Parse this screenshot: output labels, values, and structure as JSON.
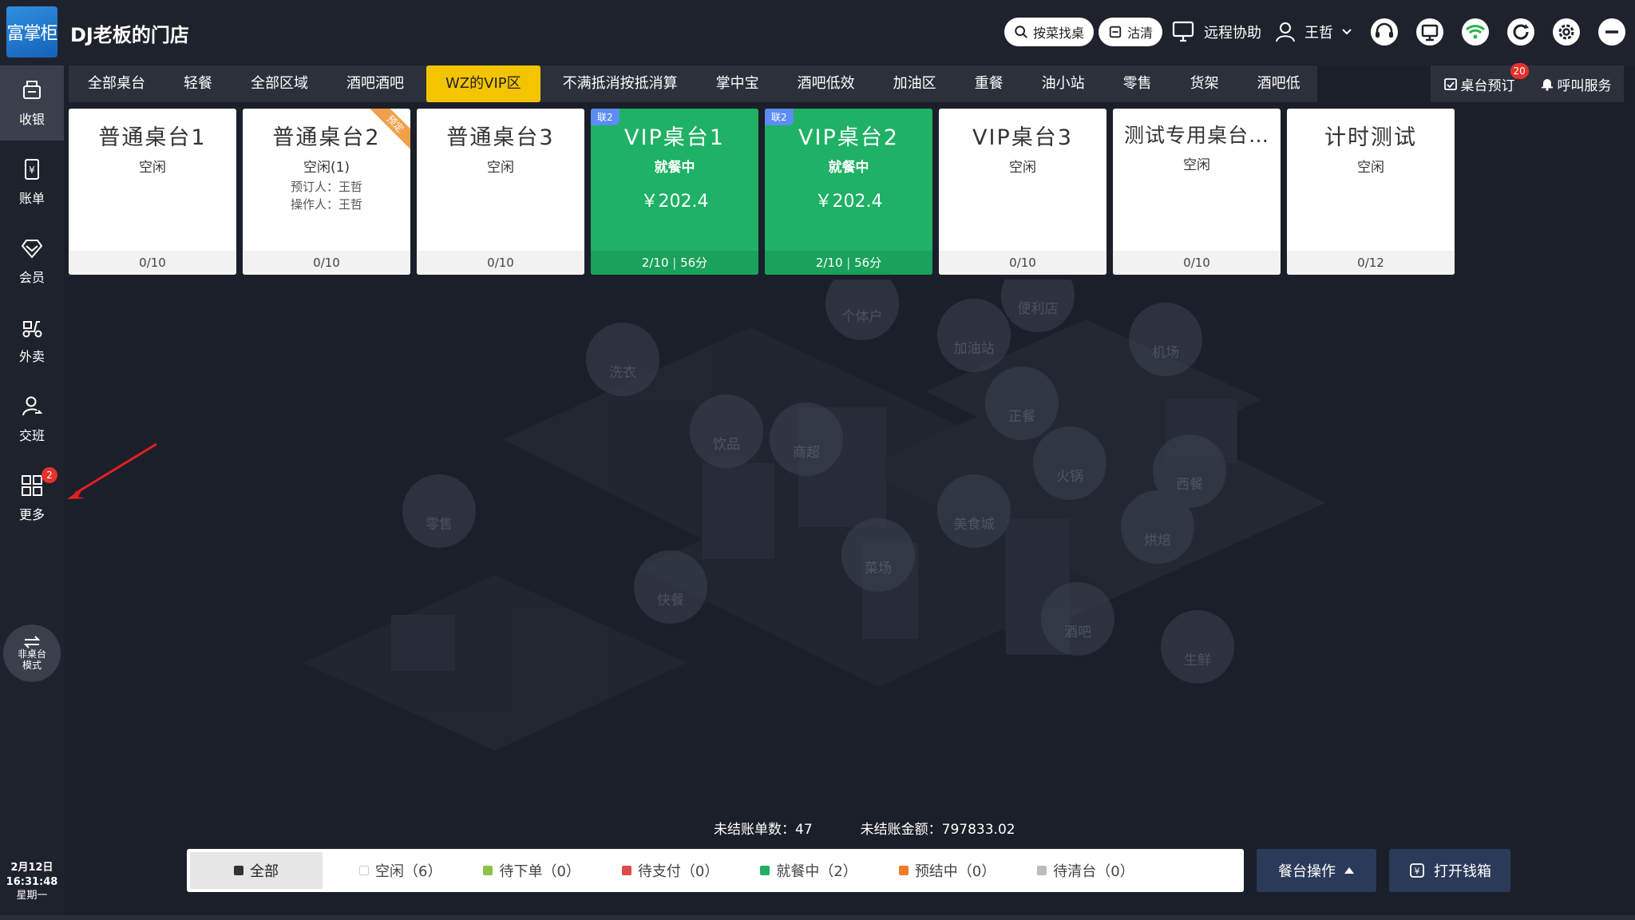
{
  "app": {
    "logo_text": "富掌柜",
    "store_name": "DJ老板的门店"
  },
  "header": {
    "search_table_label": "按菜找桌",
    "clean_label": "沽清",
    "remote_help_label": "远程协助",
    "user_name": "王哲"
  },
  "sidebar": {
    "items": [
      {
        "label": "收银"
      },
      {
        "label": "账单"
      },
      {
        "label": "会员"
      },
      {
        "label": "外卖"
      },
      {
        "label": "交班"
      },
      {
        "label": "更多",
        "badge": "2"
      }
    ],
    "mode_line1": "非桌台",
    "mode_line2": "模式",
    "date": "2月12日",
    "time": "16:31:48",
    "weekday": "星期一"
  },
  "tabs": {
    "items": [
      {
        "label": "全部桌台"
      },
      {
        "label": "轻餐"
      },
      {
        "label": "全部区域"
      },
      {
        "label": "酒吧酒吧"
      },
      {
        "label": "WZ的VIP区"
      },
      {
        "label": "不满抵消按抵消算"
      },
      {
        "label": "掌中宝"
      },
      {
        "label": "酒吧低效"
      },
      {
        "label": "加油区"
      },
      {
        "label": "重餐"
      },
      {
        "label": "油小站"
      },
      {
        "label": "零售"
      },
      {
        "label": "货架"
      },
      {
        "label": "酒吧低"
      }
    ],
    "active_index": 4,
    "reserve_label": "桌台预订",
    "reserve_badge": "20",
    "call_service_label": "呼叫服务"
  },
  "tables": [
    {
      "name": "普通桌台1",
      "status": "空闲",
      "foot": "0/10"
    },
    {
      "name": "普通桌台2",
      "status": "空闲(1)",
      "booker": "预订人：王哲",
      "operator": "操作人：王哲",
      "ribbon": "预定",
      "foot": "0/10"
    },
    {
      "name": "普通桌台3",
      "status": "空闲",
      "foot": "0/10"
    },
    {
      "name": "VIP桌台1",
      "status": "就餐中",
      "amount": "￥202.4",
      "tag": "联2",
      "foot_left": "2/10",
      "foot_right": "56分"
    },
    {
      "name": "VIP桌台2",
      "status": "就餐中",
      "amount": "￥202.4",
      "tag": "联2",
      "foot_left": "2/10",
      "foot_right": "56分"
    },
    {
      "name": "VIP桌台3",
      "status": "空闲",
      "foot": "0/10"
    },
    {
      "name": "测试专用桌台…",
      "status": "空闲",
      "foot": "0/10"
    },
    {
      "name": "计时测试",
      "status": "空闲",
      "foot": "0/12"
    }
  ],
  "summary": {
    "unsettled_count_label": "未结账单数：",
    "unsettled_count": "47",
    "unsettled_amount_label": "未结账金额：",
    "unsettled_amount": "797833.02"
  },
  "filters": {
    "all": "全部",
    "idle": "空闲（6）",
    "pending_order": "待下单（0）",
    "pending_pay": "待支付（0）",
    "dining": "就餐中（2）",
    "pre_settle": "预结中（0）",
    "pending_clean": "待清台（0）"
  },
  "colors": {
    "idle": "#ffffff",
    "pending_order": "#8bc34a",
    "pending_pay": "#e04a4a",
    "dining": "#1fb165",
    "pre_settle": "#f07b2a",
    "pending_clean": "#bbbbbb",
    "active_tab": "#f5c400"
  },
  "bottom": {
    "table_ops_label": "餐台操作",
    "open_drawer_label": "打开钱箱"
  },
  "city_labels": [
    "个体户",
    "便利店",
    "加油站",
    "机场",
    "洗衣",
    "饮品",
    "商超",
    "正餐",
    "火锅",
    "西餐",
    "美食城",
    "烘焙",
    "零售",
    "菜场",
    "快餐",
    "酒吧",
    "生鲜"
  ]
}
